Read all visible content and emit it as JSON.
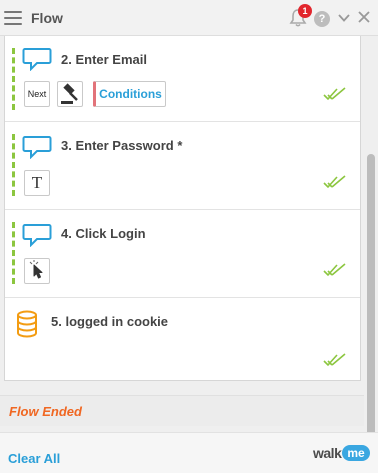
{
  "header": {
    "title": "Flow",
    "notification_count": "1",
    "help_label": "?"
  },
  "steps": [
    {
      "title": "2. Enter Email",
      "actions": {
        "next_label": "Next",
        "conditions_label": "Conditions"
      }
    },
    {
      "title": "3. Enter Password *",
      "actions": {
        "text_label": "T"
      }
    },
    {
      "title": "4. Click Login"
    },
    {
      "title": "5. logged in cookie"
    }
  ],
  "flow_status": "Flow Ended",
  "footer": {
    "clear_all": "Clear All",
    "logo_walk": "walk",
    "logo_me": "me"
  },
  "colors": {
    "accent_blue": "#2a9fd8",
    "success_green": "#8cc63f",
    "ended_orange": "#f06722",
    "badge_red": "#e2262d",
    "cookie_orange": "#f39c12"
  },
  "icons": [
    "hamburger-icon",
    "bell-icon",
    "help-icon",
    "chevron-down-icon",
    "close-icon",
    "speech-bubble-icon",
    "gavel-icon",
    "pointer-click-icon",
    "database-icon",
    "double-check-icon"
  ]
}
